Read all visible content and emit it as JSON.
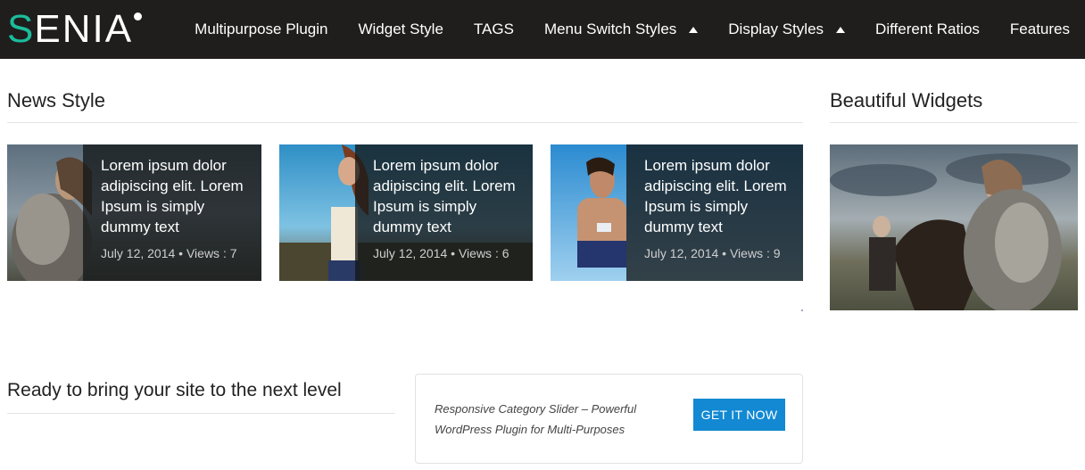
{
  "brand": {
    "first_letter": "S",
    "rest": "ENIA"
  },
  "nav": {
    "items": [
      {
        "label": "Multipurpose Plugin",
        "has_submenu": false
      },
      {
        "label": "Widget Style",
        "has_submenu": false
      },
      {
        "label": "TAGS",
        "has_submenu": false
      },
      {
        "label": "Menu Switch Styles",
        "has_submenu": true
      },
      {
        "label": "Display Styles",
        "has_submenu": true
      },
      {
        "label": "Different Ratios",
        "has_submenu": false
      },
      {
        "label": "Features",
        "has_submenu": false
      }
    ]
  },
  "news": {
    "title": "News Style",
    "cards": [
      {
        "title": "Lorem ipsum dolor adipiscing elit. Lorem Ipsum is simply dummy text",
        "meta": "July 12, 2014 • Views : 7"
      },
      {
        "title": "Lorem ipsum dolor adipiscing elit. Lorem Ipsum is simply dummy text",
        "meta": "July 12, 2014 • Views : 6"
      },
      {
        "title": "Lorem ipsum dolor adipiscing elit. Lorem Ipsum is simply dummy text",
        "meta": "July 12, 2014 • Views : 9"
      }
    ]
  },
  "widgets": {
    "title": "Beautiful Widgets"
  },
  "cta": {
    "heading": "Ready to bring your site to the next level",
    "text": "Responsive Category Slider – Powerful WordPress Plugin for Multi-Purposes",
    "button": "GET IT NOW"
  },
  "colors": {
    "header_bg": "#1f1e1d",
    "brand_accent": "#1bbc9b",
    "button_bg": "#1289d2"
  }
}
